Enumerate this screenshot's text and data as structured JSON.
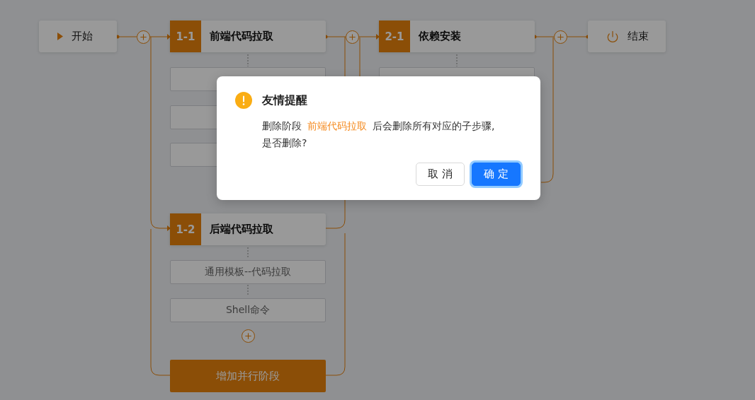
{
  "start": {
    "label": "开始"
  },
  "stage_groups": [
    {
      "stages": [
        {
          "index": "1-1",
          "title": "前端代码拉取",
          "steps": [
            {
              "kind": "blank"
            },
            {
              "kind": "blank"
            },
            {
              "kind": "blank"
            }
          ]
        },
        {
          "index": "1-2",
          "title": "后端代码拉取",
          "steps": [
            {
              "kind": "text",
              "label": "通用模板--代码拉取"
            },
            {
              "kind": "text",
              "label": "Shell命令"
            }
          ]
        }
      ],
      "add_parallel": {
        "label": "增加并行阶段"
      }
    },
    {
      "stages": [
        {
          "index": "2-1",
          "title": "依赖安装",
          "steps": [
            {
              "kind": "blank"
            }
          ]
        }
      ]
    }
  ],
  "end": {
    "label": "结束"
  },
  "dialog": {
    "title": "友情提醒",
    "message_prefix": "删除阶段",
    "stage_name": "前端代码拉取",
    "message_suffix": "后会删除所有对应的子步骤, 是否删除?",
    "buttons": [
      {
        "kind": "default",
        "label": "取 消"
      },
      {
        "kind": "primary",
        "label": "确 定"
      }
    ]
  }
}
